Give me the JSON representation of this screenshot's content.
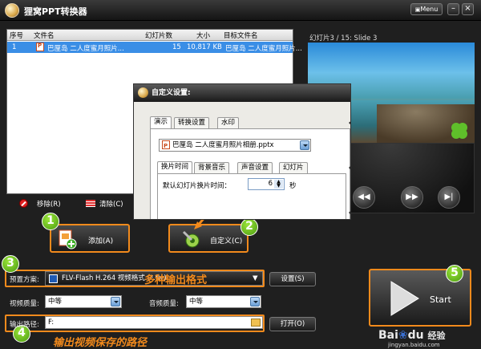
{
  "window": {
    "title": "狸窝PPT转换器",
    "menu_label": "Menu",
    "min_glyph": "–",
    "close_glyph": "×"
  },
  "table": {
    "headers": [
      "序号",
      "文件名",
      "幻灯片数",
      "大小",
      "目标文件名"
    ],
    "rows": [
      {
        "index": "1",
        "filename": "巴厘岛 二人度蜜月照片...",
        "slides": "15",
        "size": "10,817 KB",
        "target": "巴厘岛 二人度蜜月照片..."
      }
    ]
  },
  "list_toolbar": {
    "remove_label": "移除(R)",
    "clear_label": "清除(C)"
  },
  "preview": {
    "label": "幻灯片3 / 15: Slide 3"
  },
  "buttons": {
    "add_label": "添加(A)",
    "custom_label": "自定义(C)",
    "settings_label": "设置(S)",
    "open_label": "打开(O)",
    "start_label": "Start"
  },
  "settings": {
    "preset_label": "预置方案:",
    "preset_value": "FLV-Flash H.264 视频格式 (*.flv)",
    "preset_annotation": "多种输出格式",
    "video_quality_label": "视频质量:",
    "video_quality_value": "中等",
    "audio_quality_label": "音频质量:",
    "audio_quality_value": "中等",
    "output_path_label": "输出路径:",
    "output_path_value": "F:",
    "output_annotation": "输出视频保存的路径"
  },
  "dialog": {
    "title": "自定义设置:",
    "tabs": [
      "演示",
      "转换设置",
      "水印"
    ],
    "file_select": "巴厘岛 二人度蜜月照片相册.pptx",
    "inner_tabs": [
      "换片时间",
      "背景音乐",
      "声音设置",
      "幻灯片"
    ],
    "slide_time_label": "默认幻灯片换片时间：",
    "slide_time_value": "6",
    "slide_time_unit": "秒"
  },
  "steps": [
    "1",
    "2",
    "3",
    "4",
    "5"
  ],
  "watermark": {
    "brand": "Bai",
    "brand2": "du",
    "experience": "经验",
    "url": "jingyan.baidu.com"
  },
  "colors": {
    "accent_orange": "#f28a1c",
    "selection_blue": "#3a8ee6",
    "step_green": "#6cc324"
  }
}
